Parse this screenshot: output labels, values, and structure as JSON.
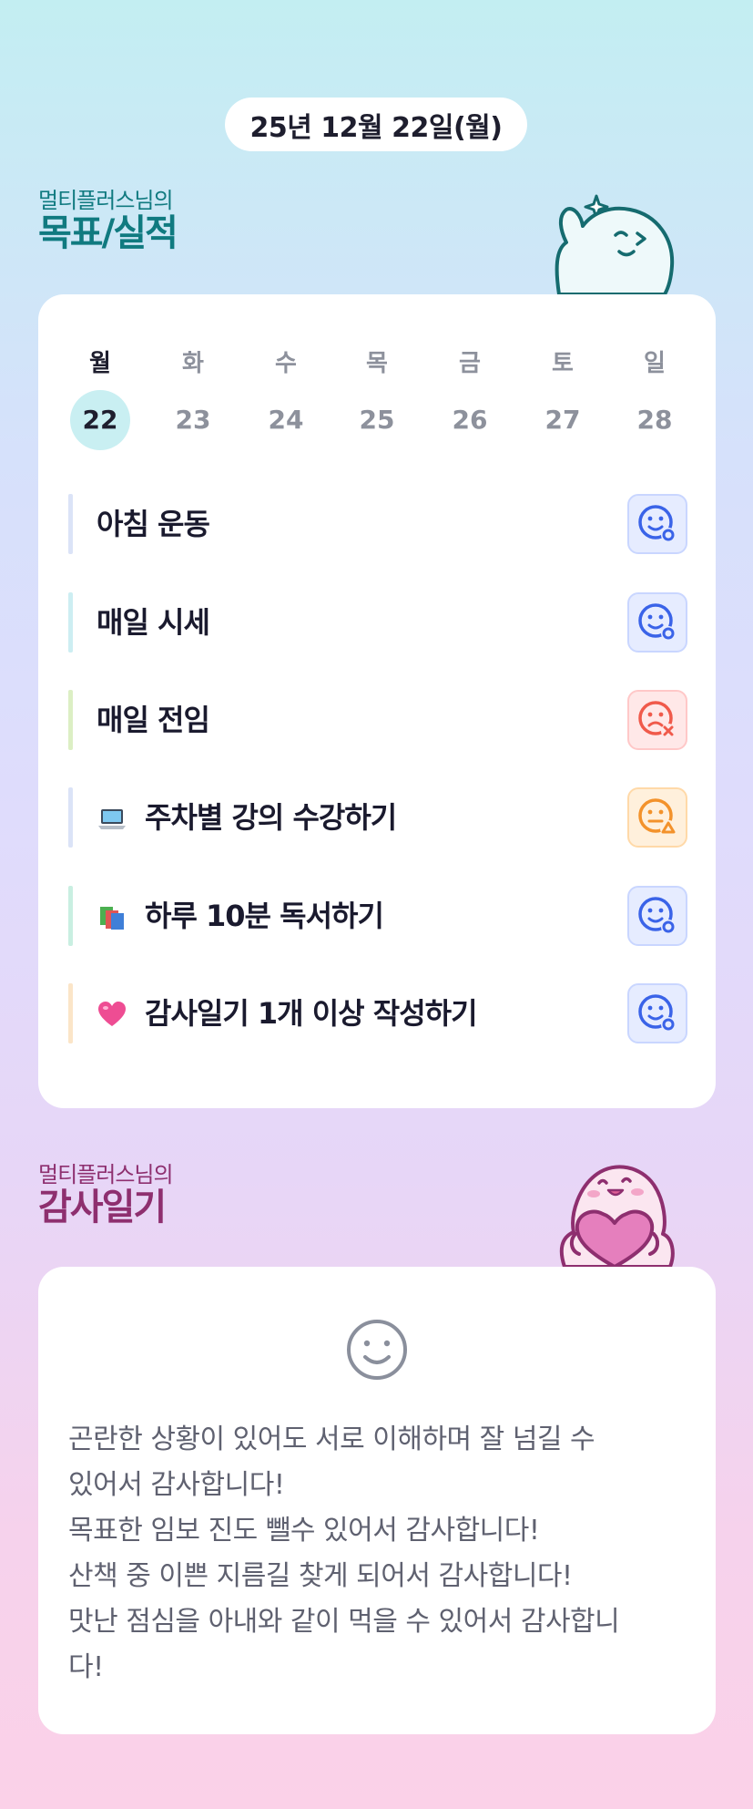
{
  "date_label": "25년 12월 22일(월)",
  "goals_section": {
    "subtitle": "멀티플러스님의",
    "title": "목표/실적"
  },
  "week": {
    "days": [
      "월",
      "화",
      "수",
      "목",
      "금",
      "토",
      "일"
    ],
    "dates": [
      "22",
      "23",
      "24",
      "25",
      "26",
      "27",
      "28"
    ],
    "selected_index": 0
  },
  "goals": [
    {
      "label": "아침 운동",
      "emoji": "",
      "bar_color": "#dbe3f7",
      "status": "success"
    },
    {
      "label": "매일 시세",
      "emoji": "",
      "bar_color": "#cdeef2",
      "status": "success"
    },
    {
      "label": "매일 전임",
      "emoji": "",
      "bar_color": "#dcefc4",
      "status": "fail"
    },
    {
      "label": "주차별 강의 수강하기",
      "emoji": "laptop-icon",
      "bar_color": "#dbe3f7",
      "status": "partial"
    },
    {
      "label": "하루 10분 독서하기",
      "emoji": "books-icon",
      "bar_color": "#c9efe1",
      "status": "success"
    },
    {
      "label": "감사일기 1개 이상 작성하기",
      "emoji": "heart-icon",
      "bar_color": "#fbe5c8",
      "status": "success"
    }
  ],
  "status_colors": {
    "success": "#3a63e8",
    "fail": "#f05a4b",
    "partial": "#f3922b"
  },
  "thanks_section": {
    "subtitle": "멀티플러스님의",
    "title": "감사일기",
    "lines": [
      "곤란한 상황이 있어도 서로 이해하며 잘 넘길 수",
      "있어서 감사합니다!",
      "목표한 임보 진도 뺄수 있어서 감사합니다!",
      "산책 중 이쁜 지름길 찾게 되어서 감사합니다!",
      "맛난 점심을 아내와 같이 먹을 수 있어서 감사합니",
      "다!"
    ]
  }
}
